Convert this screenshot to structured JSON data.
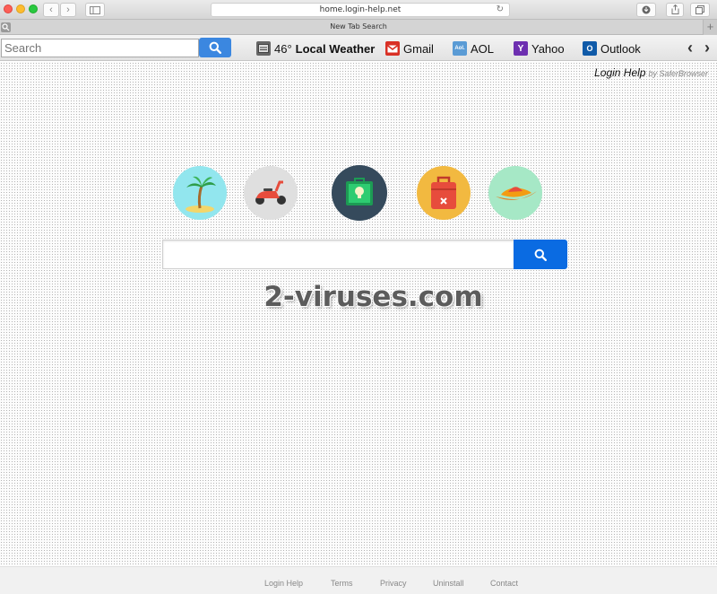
{
  "browser": {
    "url": "home.login-help.net",
    "tab_title": "New Tab Search",
    "back_glyph": "‹",
    "forward_glyph": "›",
    "new_tab_glyph": "+"
  },
  "toolbar": {
    "search_placeholder": "Search",
    "weather": {
      "temp": "46°",
      "label": "Local Weather"
    },
    "links": [
      {
        "label": "Gmail",
        "icon": "gmail-icon"
      },
      {
        "label": "AOL",
        "icon": "aol-icon"
      },
      {
        "label": "Yahoo",
        "icon": "yahoo-icon"
      },
      {
        "label": "Outlook",
        "icon": "outlook-icon"
      }
    ],
    "icon_text": {
      "aol": "Aol.",
      "yahoo": "Y",
      "outlook": "O"
    },
    "scroll_left": "‹",
    "scroll_right": "›"
  },
  "brand": {
    "name": "Login Help",
    "by": "by SaferBrowser"
  },
  "categories": [
    {
      "icon": "palm-beach-icon",
      "color": "#92e6ee"
    },
    {
      "icon": "scooter-icon",
      "color": "#dfdfdf"
    },
    {
      "icon": "business-idea-icon",
      "color": "#354a5c"
    },
    {
      "icon": "luggage-icon",
      "color": "#f2b940"
    },
    {
      "icon": "sombrero-icon",
      "color": "#a6e8c6"
    }
  ],
  "watermark": "2-viruses.com",
  "footer": {
    "links": [
      "Login Help",
      "Terms",
      "Privacy",
      "Uninstall",
      "Contact"
    ]
  },
  "colors": {
    "search_blue": "#0a6be2",
    "toolbar_search_blue": "#3b87e0"
  }
}
